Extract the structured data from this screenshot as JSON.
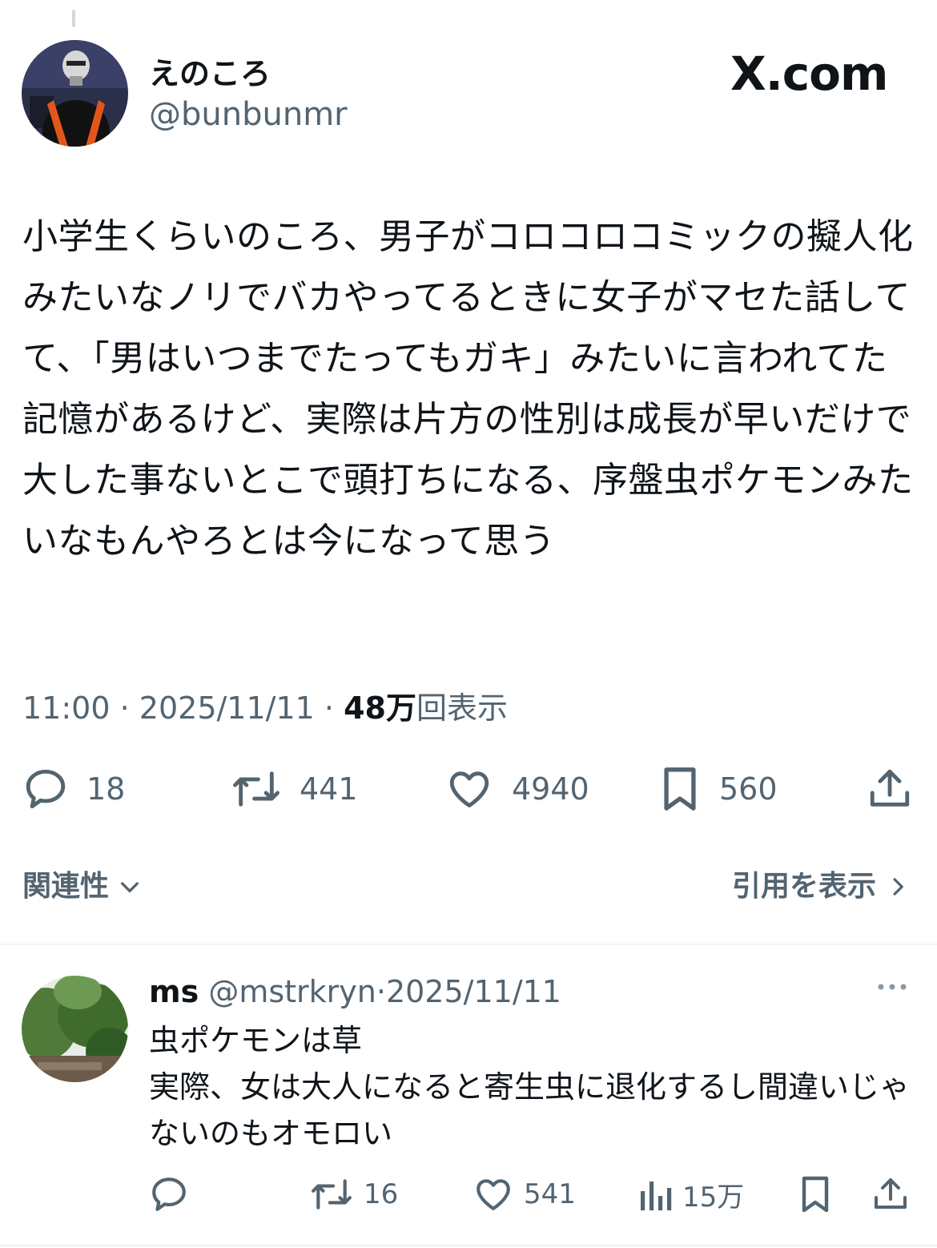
{
  "tweet": {
    "display_name": "えのころ",
    "handle": "@bunbunmr",
    "site_label": "X.com",
    "text": "小学生くらいのころ、男子がコロコロコミックの擬人化みたいなノリでバカやってるときに女子がマセた話してて、「男はいつまでたってもガキ」みたいに言われてた記憶があるけど、実際は片方の性別は成長が早いだけで大した事ないとこで頭打ちになる、序盤虫ポケモンみたいなもんやろとは今になって思う",
    "time": "11:00",
    "date": "2025/11/11",
    "views_number": "48万",
    "views_label": "回表示",
    "separator": "·",
    "actions": {
      "replies": "18",
      "reposts": "441",
      "likes": "4940",
      "bookmarks": "560"
    },
    "icons": [
      "reply-icon",
      "repost-icon",
      "like-icon",
      "bookmark-icon",
      "share-icon"
    ]
  },
  "relevance_label": "関連性",
  "quote_label": "引用を表示",
  "reply": {
    "display_name": "ms",
    "handle": "@mstrkryn",
    "separator": "·",
    "date": "2025/11/11",
    "text": "虫ポケモンは草\n実際、女は大人になると寄生虫に退化するし間違いじゃないのもオモロい",
    "actions": {
      "reposts": "16",
      "likes": "541",
      "views": "15万"
    },
    "icons": [
      "reply-icon",
      "repost-icon",
      "like-icon",
      "views-icon",
      "bookmark-icon",
      "share-icon",
      "more-icon"
    ]
  },
  "colors": {
    "text": "#0f1419",
    "secondary": "#536471",
    "divider": "#eff3f4"
  }
}
